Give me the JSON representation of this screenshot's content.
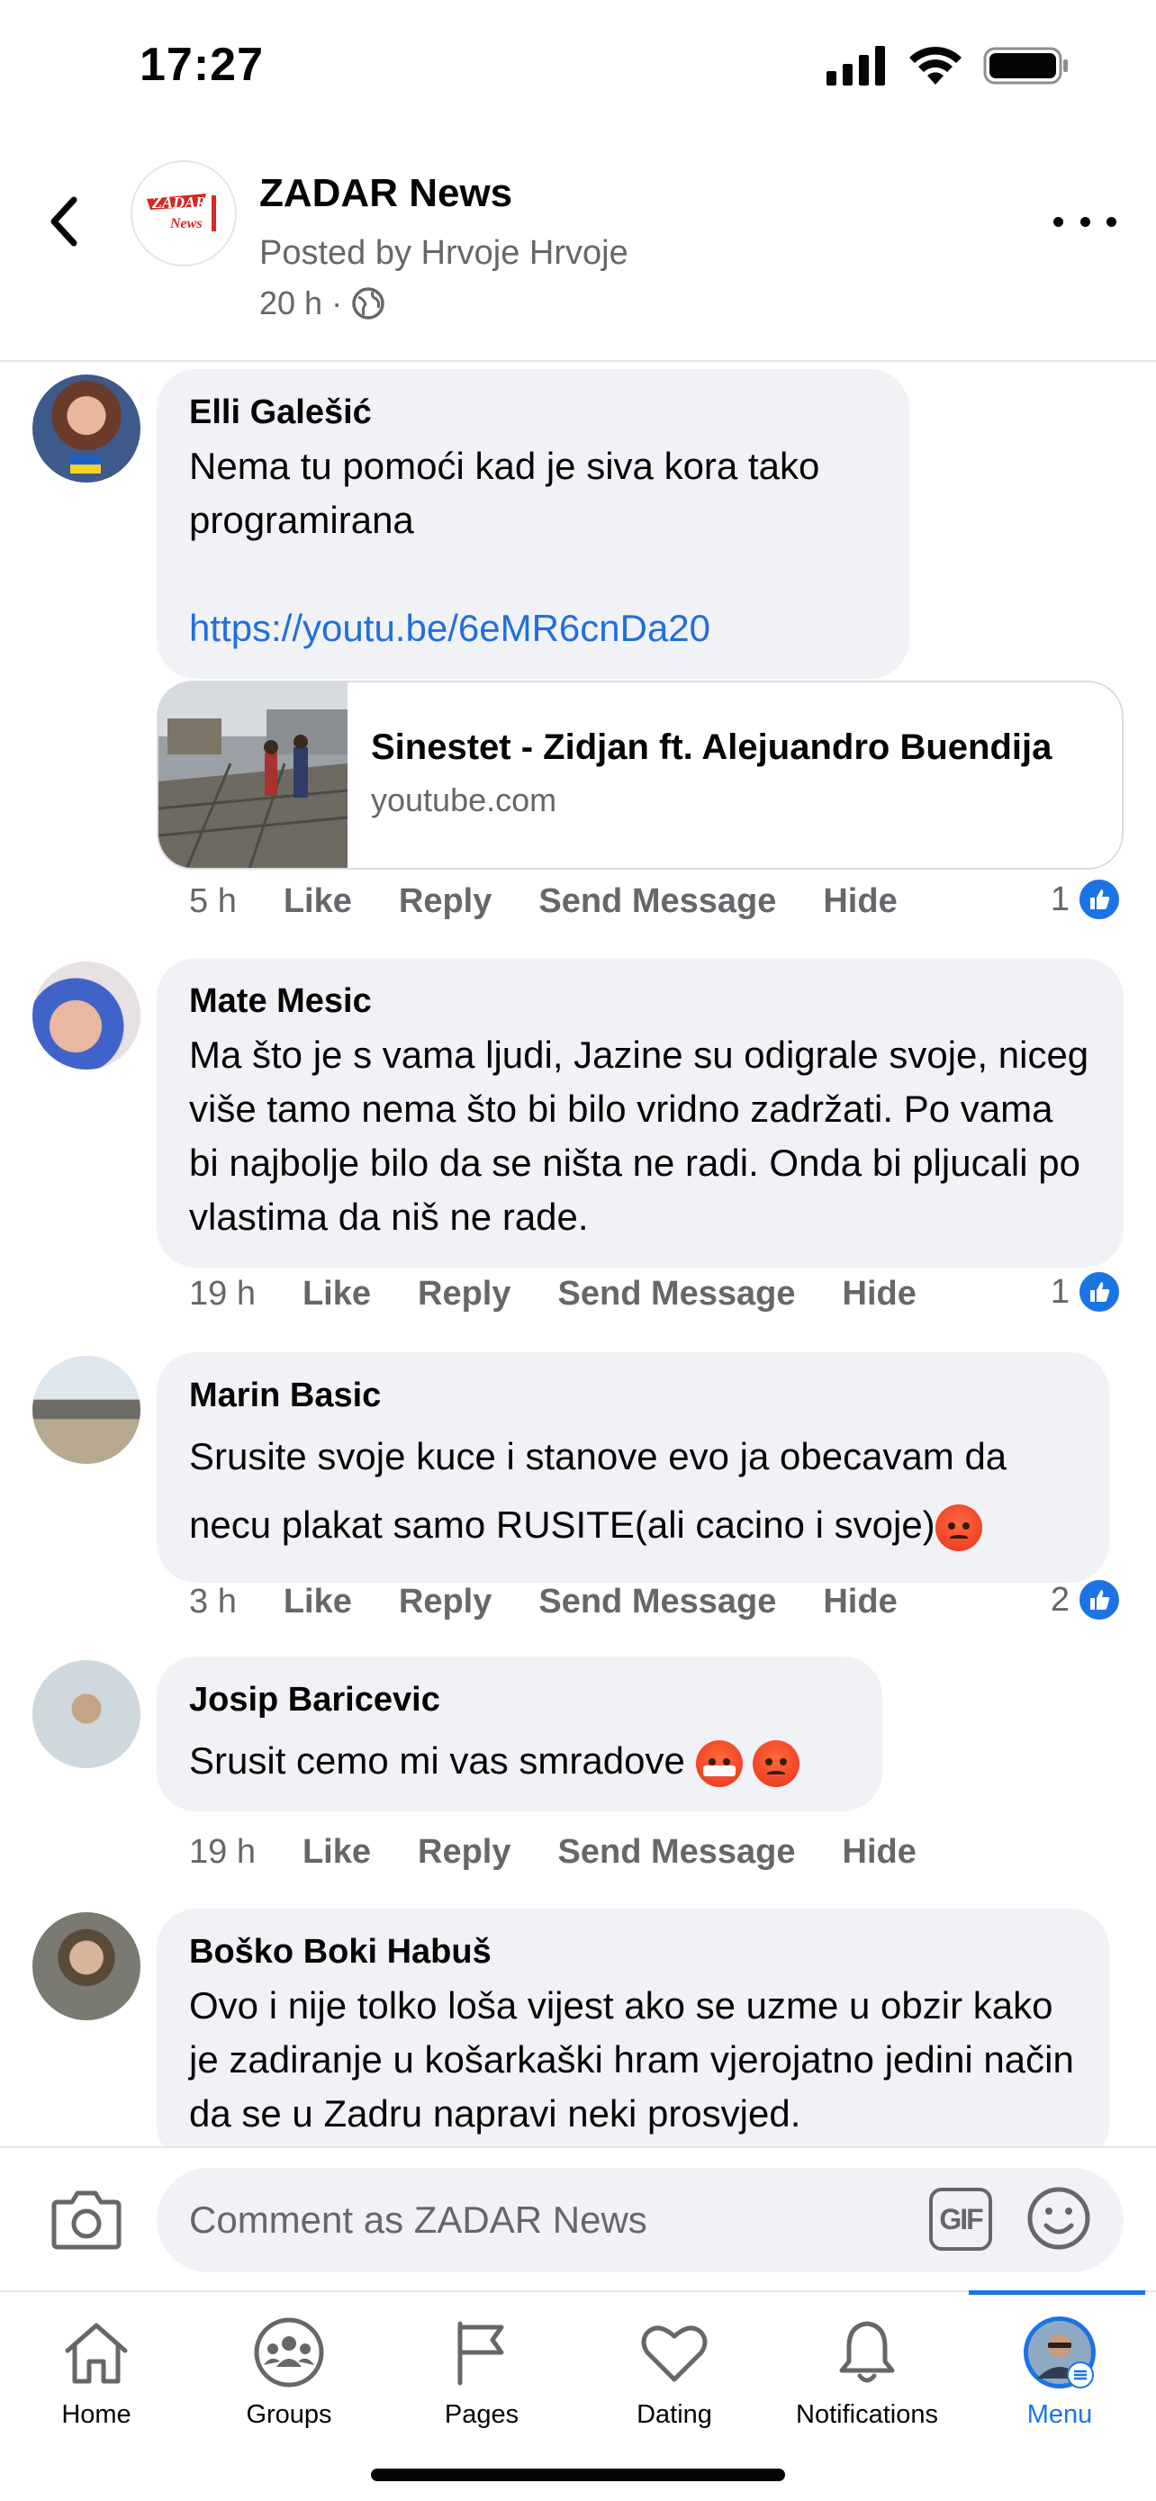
{
  "status_bar": {
    "time": "17:27"
  },
  "header": {
    "page_name": "ZADAR News",
    "posted_by": "Posted by Hrvoje Hrvoje",
    "time": "20 h",
    "separator": "·",
    "logo_text": "ZADAR News"
  },
  "comments": [
    {
      "author": "Elli Galešić",
      "text": "Nema tu pomoći kad je siva kora tako programirana",
      "link": "https://youtu.be/6eMR6cnDa20",
      "preview": {
        "title": "Sinestet - Zidjan ft. Alejuandro Buendija",
        "domain": "youtube.com"
      },
      "time": "5 h",
      "like_label": "Like",
      "reply_label": "Reply",
      "send_label": "Send Message",
      "hide_label": "Hide",
      "reactions": "1"
    },
    {
      "author": "Mate Mesic",
      "text": "Ma što je s vama ljudi, Jazine su odigrale svoje, niceg više tamo nema što bi bilo vridno zadržati. Po vama bi najbolje bilo da se ništa ne radi. Onda bi pljucali po vlastima da niš ne rade.",
      "time": "19 h",
      "like_label": "Like",
      "reply_label": "Reply",
      "send_label": "Send Message",
      "hide_label": "Hide",
      "reactions": "1"
    },
    {
      "author": "Marin Basic",
      "text": "Srusite svoje kuce i stanove evo ja obecavam da necu plakat samo RUSITE(ali cacino i svoje)",
      "time": "3 h",
      "like_label": "Like",
      "reply_label": "Reply",
      "send_label": "Send Message",
      "hide_label": "Hide",
      "reactions": "2"
    },
    {
      "author": "Josip Baricevic",
      "text": "Srusit cemo mi vas smradove",
      "time": "19 h",
      "like_label": "Like",
      "reply_label": "Reply",
      "send_label": "Send Message",
      "hide_label": "Hide"
    },
    {
      "author": "Boško Boki Habuš",
      "text": "Ovo i nije tolko loša vijest ako se uzme u obzir kako je zadiranje u košarkaški hram vjerojatno jedini način da se u Zadru napravi neki prosvjed."
    }
  ],
  "composer": {
    "placeholder": "Comment as ZADAR News",
    "gif_label": "GIF"
  },
  "tabs": [
    {
      "label": "Home",
      "icon": "home-icon"
    },
    {
      "label": "Groups",
      "icon": "groups-icon"
    },
    {
      "label": "Pages",
      "icon": "flag-icon"
    },
    {
      "label": "Dating",
      "icon": "heart-icon"
    },
    {
      "label": "Notifications",
      "icon": "bell-icon"
    },
    {
      "label": "Menu",
      "icon": "profile-menu-icon",
      "active": true
    }
  ],
  "colors": {
    "accent": "#1b74e4",
    "link": "#216fdb",
    "bubble": "#f0f2f5",
    "secondary_text": "#65676b"
  }
}
